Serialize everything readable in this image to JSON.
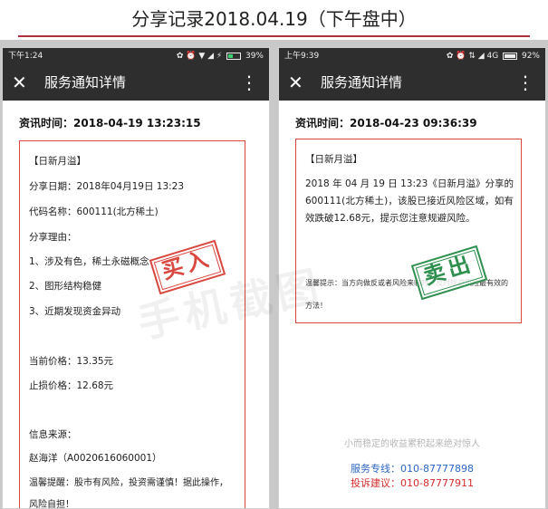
{
  "page_title": "分享记录2018.04.19（下午盘中）",
  "left": {
    "status": {
      "time": "下午1:24",
      "icons": "✿ ⏰ ▼ ◢ ⚡",
      "battery": "39%"
    },
    "toolbar": {
      "close": "✕",
      "title": "服务通知详情",
      "more": "⋮"
    },
    "info_time": "资讯时间：2018-04-19 13:23:15",
    "card": {
      "brand": "【日新月溢】",
      "share_date": "分享日期：2018年04月19日  13:23",
      "code_name": "代码名称：600111(北方稀土)",
      "reason_label": "分享理由：",
      "reason_1": "1、涉及有色，稀土永磁概念",
      "reason_2": "2、图形结构稳健",
      "reason_3": "3、近期发现资金异动",
      "current_price": "当前价格：13.35元",
      "stop_price": "止损价格：12.68元",
      "source_label": "信息来源：",
      "source": "赵海洋（A0020616060001）",
      "warning": "温馨提醒：股市有风险，投资需谨慎！据此操作，",
      "warning_cont": "风险自担！"
    },
    "stamp": "买入"
  },
  "right": {
    "status": {
      "time": "上午9:39",
      "icons": "✿ ⏰ ⇅ ◢ 4G",
      "battery": "92%"
    },
    "toolbar": {
      "close": "✕",
      "title": "服务通知详情",
      "more": "⋮"
    },
    "info_time": "资讯时间：2018-04-23 09:36:39",
    "card": {
      "brand": "【日新月溢】",
      "body": "2018 年 04 月 19 日  13:23《日新月溢》分享的 600111(北方稀土)，该股已接近风险区域，如有效跌破12.68元，提示您注意规避风险。",
      "tip": "温馨提示：当方向做反或者风险来临时，及时规避风险最有效的方法！"
    },
    "stamp": "卖出",
    "footer": {
      "slogan": "小而稳定的收益累积起来绝对惊人",
      "service": "服务专线：010-87777898",
      "complaint": "投诉建议：010-87777911"
    }
  },
  "watermark": "手机截图",
  "colors": {
    "accent_red": "#d9473f",
    "stamp_green": "#2f8f4e",
    "link_blue": "#2b66c6",
    "header_dark": "#2e2e2e"
  }
}
